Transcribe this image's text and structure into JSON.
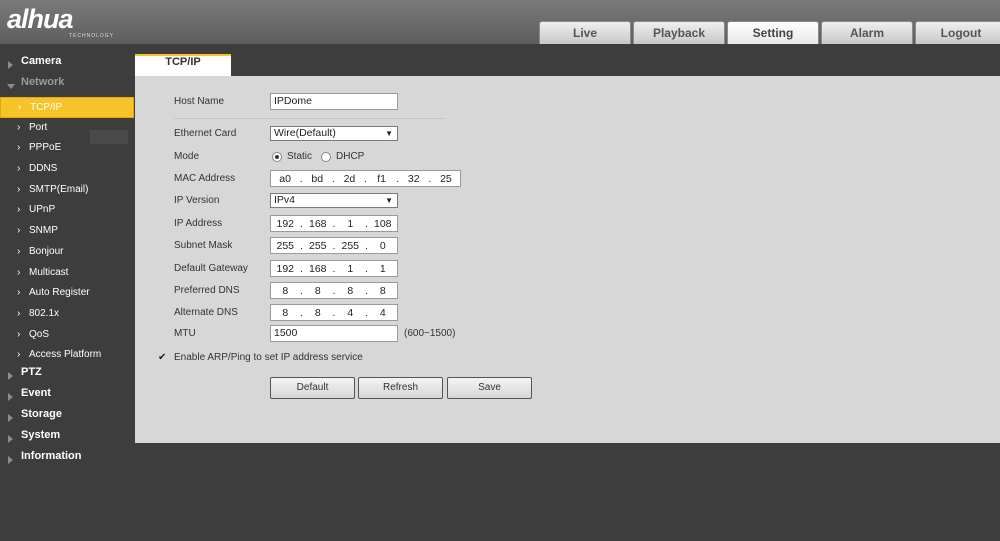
{
  "brand": {
    "name": "alhua",
    "tagline": "TECHNOLOGY"
  },
  "tabs": [
    "Live",
    "Playback",
    "Setting",
    "Alarm",
    "Logout"
  ],
  "sidebar": {
    "camera": "Camera",
    "network": "Network",
    "network_items": [
      "TCP/IP",
      "Port",
      "PPPoE",
      "DDNS",
      "SMTP(Email)",
      "UPnP",
      "SNMP",
      "Bonjour",
      "Multicast",
      "Auto Register",
      "802.1x",
      "QoS",
      "Access Platform"
    ],
    "rest": [
      "PTZ",
      "Event",
      "Storage",
      "System",
      "Information"
    ]
  },
  "panel_tab": "TCP/IP",
  "form": {
    "host_name": {
      "label": "Host Name",
      "value": "IPDome"
    },
    "ethernet_card": {
      "label": "Ethernet Card",
      "value": "Wire(Default)"
    },
    "mode": {
      "label": "Mode",
      "static": "Static",
      "dhcp": "DHCP",
      "selected": "Static"
    },
    "mac": {
      "label": "MAC Address",
      "parts": [
        "a0",
        "bd",
        "2d",
        "f1",
        "32",
        "25"
      ]
    },
    "ip_version": {
      "label": "IP Version",
      "value": "IPv4"
    },
    "ip_address": {
      "label": "IP Address",
      "parts": [
        "192",
        "168",
        "1",
        "108"
      ]
    },
    "subnet": {
      "label": "Subnet Mask",
      "parts": [
        "255",
        "255",
        "255",
        "0"
      ]
    },
    "gateway": {
      "label": "Default Gateway",
      "parts": [
        "192",
        "168",
        "1",
        "1"
      ]
    },
    "pref_dns": {
      "label": "Preferred DNS",
      "parts": [
        "8",
        "8",
        "8",
        "8"
      ]
    },
    "alt_dns": {
      "label": "Alternate DNS",
      "parts": [
        "8",
        "8",
        "4",
        "4"
      ]
    },
    "mtu": {
      "label": "MTU",
      "value": "1500",
      "hint": "(600~1500)"
    },
    "arp": {
      "label": "Enable ARP/Ping to set IP address service",
      "checked": true
    }
  },
  "buttons": {
    "default": "Default",
    "refresh": "Refresh",
    "save": "Save"
  }
}
